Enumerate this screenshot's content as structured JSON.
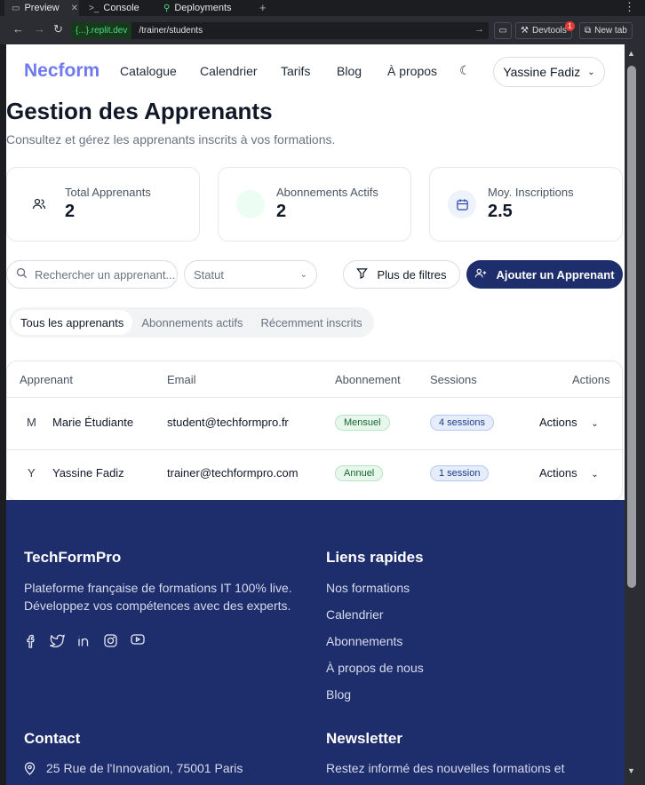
{
  "browser": {
    "tabs": [
      {
        "label": "Preview",
        "icon": "monitor-icon",
        "active": true
      },
      {
        "label": "Console",
        "icon": "terminal-icon",
        "active": false
      },
      {
        "label": "Deployments",
        "icon": "deploy-icon",
        "active": false
      }
    ],
    "url_host": "{...}.replit.dev",
    "url_path": "/trainer/students",
    "devtools_label": "Devtools",
    "devtools_badge": "1",
    "newtab_label": "New tab"
  },
  "header": {
    "logo": "Necform",
    "nav": [
      "Catalogue",
      "Calendrier",
      "Tarifs",
      "Blog",
      "À propos"
    ],
    "user": "Yassine Fadiz"
  },
  "page": {
    "title": "Gestion des Apprenants",
    "subtitle": "Consultez et gérez les apprenants inscrits à vos formations."
  },
  "stats": [
    {
      "label": "Total Apprenants",
      "value": "2",
      "icon": "users-icon"
    },
    {
      "label": "Abonnements Actifs",
      "value": "2",
      "icon": "subscription-icon"
    },
    {
      "label": "Moy. Inscriptions",
      "value": "2.5",
      "icon": "calendar-icon"
    }
  ],
  "filters": {
    "search_placeholder": "Rechercher un apprenant...",
    "status_placeholder": "Statut",
    "more_filters": "Plus de filtres",
    "add_button": "Ajouter un Apprenant"
  },
  "tabs": [
    "Tous les apprenants",
    "Abonnements actifs",
    "Récemment inscrits"
  ],
  "table": {
    "columns": [
      "Apprenant",
      "Email",
      "Abonnement",
      "Sessions",
      "Actions"
    ],
    "rows": [
      {
        "initial": "M",
        "name": "Marie Étudiante",
        "email": "student@techformpro.fr",
        "subscription": "Mensuel",
        "sessions": "4 sessions",
        "actions": "Actions"
      },
      {
        "initial": "Y",
        "name": "Yassine Fadiz",
        "email": "trainer@techformpro.com",
        "subscription": "Annuel",
        "sessions": "1 session",
        "actions": "Actions"
      }
    ]
  },
  "footer": {
    "brand": "TechFormPro",
    "tagline_1": "Plateforme française de formations IT 100% live.",
    "tagline_2": "Développez vos compétences avec des experts.",
    "social": [
      "facebook-icon",
      "twitter-icon",
      "linkedin-icon",
      "instagram-icon",
      "youtube-icon"
    ],
    "quick_links_title": "Liens rapides",
    "quick_links": [
      "Nos formations",
      "Calendrier",
      "Abonnements",
      "À propos de nous",
      "Blog"
    ],
    "contact_title": "Contact",
    "address": "25 Rue de l'Innovation, 75001 Paris",
    "newsletter_title": "Newsletter",
    "newsletter_text": "Restez informé des nouvelles formations et"
  }
}
